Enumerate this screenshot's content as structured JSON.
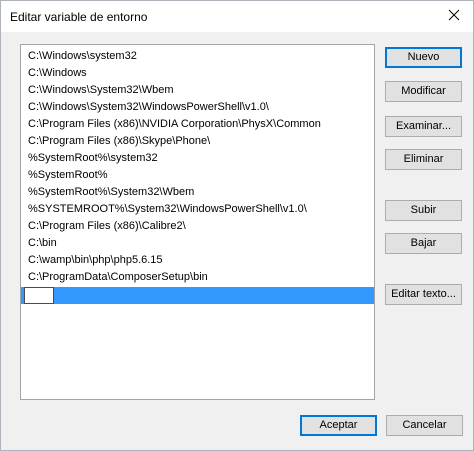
{
  "window": {
    "title": "Editar variable de entorno"
  },
  "list": {
    "items": [
      "C:\\Windows\\system32",
      "C:\\Windows",
      "C:\\Windows\\System32\\Wbem",
      "C:\\Windows\\System32\\WindowsPowerShell\\v1.0\\",
      "C:\\Program Files (x86)\\NVIDIA Corporation\\PhysX\\Common",
      "C:\\Program Files (x86)\\Skype\\Phone\\",
      "%SystemRoot%\\system32",
      "%SystemRoot%",
      "%SystemRoot%\\System32\\Wbem",
      "%SYSTEMROOT%\\System32\\WindowsPowerShell\\v1.0\\",
      "C:\\Program Files (x86)\\Calibre2\\",
      "C:\\bin",
      "C:\\wamp\\bin\\php\\php5.6.15",
      "C:\\ProgramData\\ComposerSetup\\bin"
    ],
    "editing_value": ""
  },
  "buttons": {
    "nuevo": "Nuevo",
    "modificar": "Modificar",
    "examinar": "Examinar...",
    "eliminar": "Eliminar",
    "subir": "Subir",
    "bajar": "Bajar",
    "editar_texto": "Editar texto...",
    "aceptar": "Aceptar",
    "cancelar": "Cancelar"
  },
  "colors": {
    "selection": "#3399ff",
    "default_button_border": "#0078d7"
  }
}
